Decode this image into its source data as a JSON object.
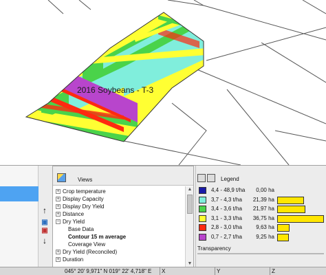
{
  "map": {
    "field_label": "2016 Soybeans - T-3"
  },
  "toolbar": {
    "up_arrow": "↑",
    "down_arrow": "↓"
  },
  "views": {
    "title": "Views",
    "items": [
      {
        "label": "Crop temperature",
        "expander": "+",
        "level": 0
      },
      {
        "label": "Display Capacity",
        "expander": "+",
        "level": 0
      },
      {
        "label": "Display Dry Yield",
        "expander": "+",
        "level": 0
      },
      {
        "label": "Distance",
        "expander": "+",
        "level": 0
      },
      {
        "label": "Dry Yield",
        "expander": "−",
        "level": 0
      },
      {
        "label": "Base Data",
        "expander": "",
        "level": 1
      },
      {
        "label": "Contour 15 m average",
        "expander": "",
        "level": 1,
        "selected": true
      },
      {
        "label": "Coverage View",
        "expander": "",
        "level": 1
      },
      {
        "label": "Dry Yield (Reconciled)",
        "expander": "+",
        "level": 0
      },
      {
        "label": "Duration",
        "expander": "+",
        "level": 0
      }
    ]
  },
  "legend": {
    "title": "Legend",
    "rows": [
      {
        "range": "4,4 - 48,9 t/ha",
        "area": "0,00 ha",
        "color": "#1a1aa8",
        "pct": 0.0
      },
      {
        "range": "3,7 - 4,3 t/ha",
        "area": "21,39 ha",
        "color": "#80eedc",
        "pct": 0.58
      },
      {
        "range": "3,4 - 3,6 t/ha",
        "area": "21,97 ha",
        "color": "#4ad34a",
        "pct": 0.6
      },
      {
        "range": "3,1 - 3,3 t/ha",
        "area": "36,75 ha",
        "color": "#ffff33",
        "pct": 1.0
      },
      {
        "range": "2,8 - 3,0 t/ha",
        "area": "9,63 ha",
        "color": "#ff2a10",
        "pct": 0.26
      },
      {
        "range": "0,7 - 2,7 t/ha",
        "area": "9,25 ha",
        "color": "#b845cc",
        "pct": 0.25
      }
    ],
    "transparency_label": "Transparency"
  },
  "status": {
    "coordinates": "045° 20' 9,971\" N  019° 22' 4,718\" E",
    "x_label": "X",
    "y_label": "Y",
    "z_label": "Z"
  },
  "colors": {
    "selection": "#4ea3f2",
    "yield_high": "#80eedc",
    "yield_mid": "#ffff33"
  }
}
